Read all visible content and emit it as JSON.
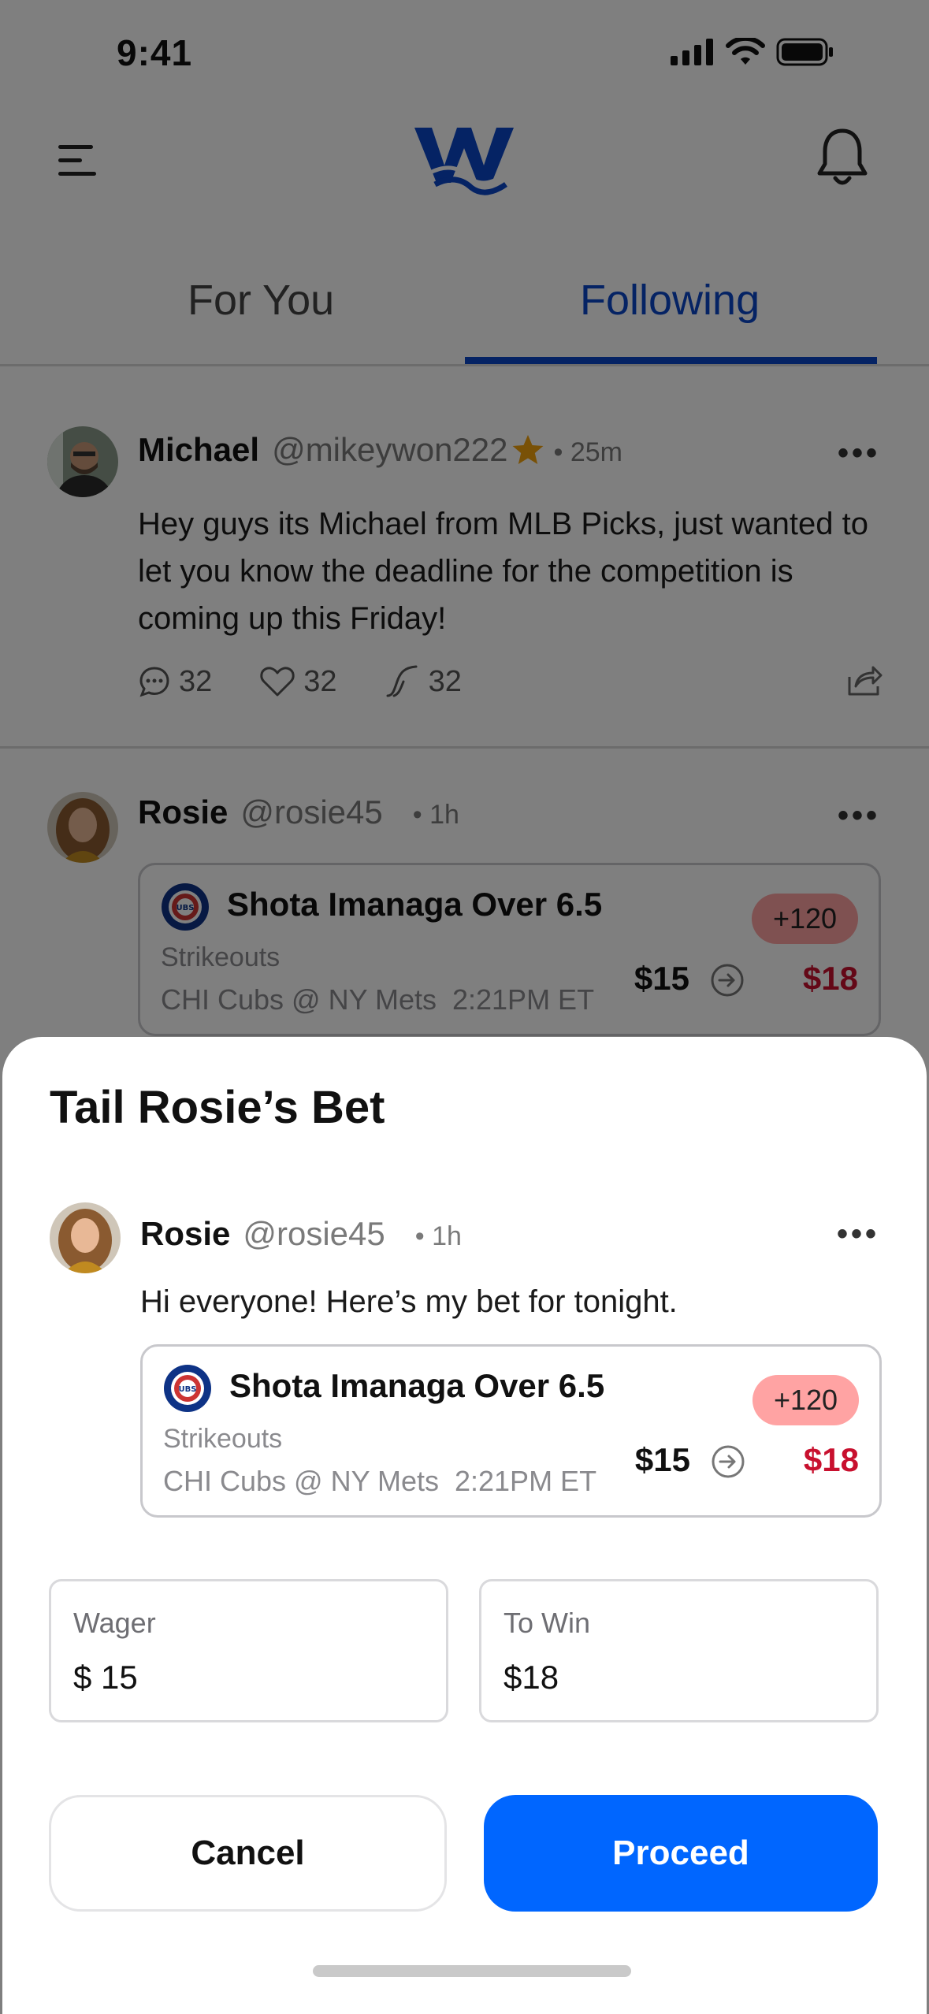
{
  "status_bar": {
    "time": "9:41"
  },
  "tabs": [
    {
      "label": "For You",
      "active": false
    },
    {
      "label": "Following",
      "active": true
    }
  ],
  "feed": [
    {
      "name": "Michael",
      "handle": "@mikeywon222",
      "verified_star": true,
      "time": "• 25m",
      "text": "Hey guys its Michael from MLB Picks, just wanted to let you know the deadline for the competition is coming up this Friday!",
      "comments": "32",
      "likes": "32",
      "tails": "32"
    },
    {
      "name": "Rosie",
      "handle": "@rosie45",
      "time": "• 1h",
      "bet": {
        "title": "Shota Imanaga Over 6.5",
        "subtitle": "Strikeouts",
        "match": "CHI Cubs @ NY Mets",
        "match_time": "2:21PM ET",
        "odds": "+120",
        "wager": "$15",
        "win": "$18"
      }
    }
  ],
  "sheet": {
    "title": "Tail Rosie’s Bet",
    "post": {
      "name": "Rosie",
      "handle": "@rosie45",
      "time": "• 1h",
      "text": "Hi everyone! Here’s my bet for tonight.",
      "bet": {
        "title": "Shota Imanaga Over 6.5",
        "subtitle": "Strikeouts",
        "match": "CHI Cubs @ NY Mets",
        "match_time": "2:21PM ET",
        "odds": "+120",
        "wager": "$15",
        "win": "$18"
      }
    },
    "wager_label": "Wager",
    "wager_value": "$ 15",
    "towin_label": "To Win",
    "towin_value": "$18",
    "cancel_label": "Cancel",
    "proceed_label": "Proceed"
  },
  "colors": {
    "brand_blue": "#0a46c9",
    "proceed_blue": "#0066ff",
    "win_red": "#c8102e",
    "odds_badge": "#ffa3a3",
    "star": "#f2a20c"
  },
  "icons": [
    "menu-icon",
    "logo",
    "bell-icon",
    "comment-icon",
    "heart-icon",
    "tail-icon",
    "share-icon",
    "cubs-logo",
    "arrow-right-circle-icon",
    "star-icon"
  ]
}
